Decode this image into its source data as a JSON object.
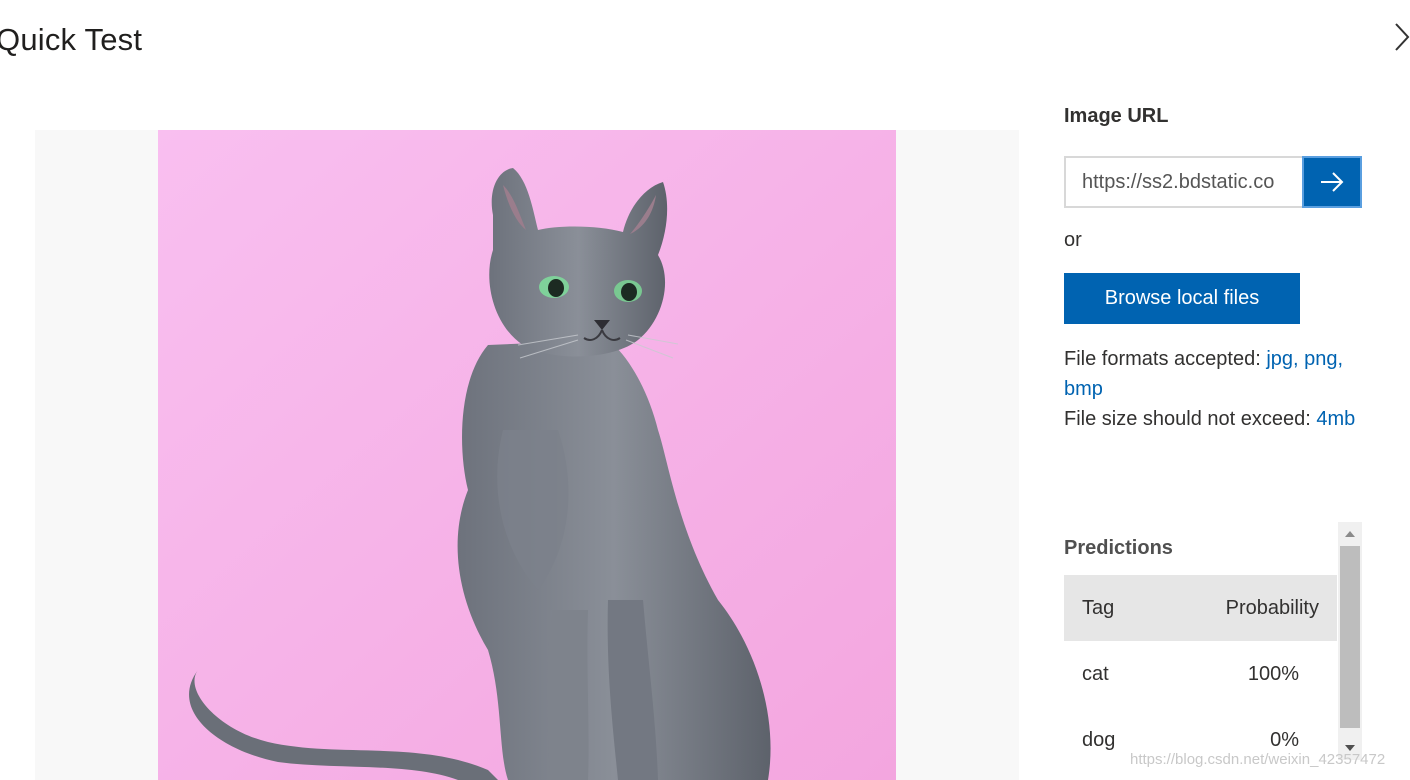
{
  "dialog": {
    "title": "Quick Test"
  },
  "input_panel": {
    "image_url_label": "Image URL",
    "url_value": "https://ss2.bdstatic.co",
    "or_text": "or",
    "browse_label": "Browse local files",
    "formats_prefix": "File formats accepted: ",
    "formats_value": "jpg, png, bmp",
    "size_prefix": "File size should not exceed: ",
    "size_value": "4mb"
  },
  "predictions": {
    "label": "Predictions",
    "columns": [
      "Tag",
      "Probability"
    ],
    "rows": [
      {
        "tag": "cat",
        "probability": "100%"
      },
      {
        "tag": "dog",
        "probability": "0%"
      }
    ]
  },
  "watermark": "https://blog.csdn.net/weixin_42357472",
  "colors": {
    "accent": "#0063b1",
    "photo_background": "#f6b3e6",
    "header_row": "#e6e6e6"
  },
  "icons": {
    "close": "close-icon",
    "go": "arrow-right-icon",
    "scroll_up": "caret-up-icon",
    "scroll_down": "caret-down-icon"
  }
}
